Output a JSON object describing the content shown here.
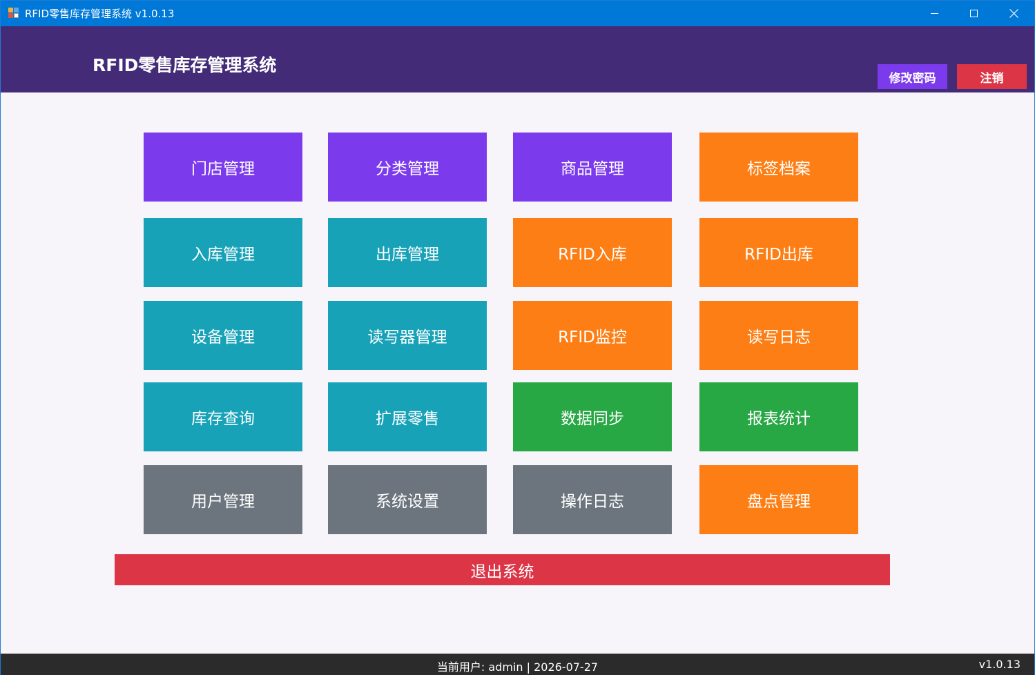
{
  "window": {
    "title": "RFID零售库存管理系统 v1.0.13",
    "icons": {
      "minimize": "minimize-icon",
      "maximize": "maximize-icon",
      "close": "close-icon"
    }
  },
  "header": {
    "title": "RFID零售库存管理系统",
    "change_password": "修改密码",
    "logout": "注销"
  },
  "tiles": [
    {
      "label": "门店管理",
      "color": "#7c3aed"
    },
    {
      "label": "分类管理",
      "color": "#7c3aed"
    },
    {
      "label": "商品管理",
      "color": "#7c3aed"
    },
    {
      "label": "标签档案",
      "color": "#fd7e14"
    },
    {
      "label": "入库管理",
      "color": "#17a2b8"
    },
    {
      "label": "出库管理",
      "color": "#17a2b8"
    },
    {
      "label": "RFID入库",
      "color": "#fd7e14"
    },
    {
      "label": "RFID出库",
      "color": "#fd7e14"
    },
    {
      "label": "设备管理",
      "color": "#17a2b8"
    },
    {
      "label": "读写器管理",
      "color": "#17a2b8"
    },
    {
      "label": "RFID监控",
      "color": "#fd7e14"
    },
    {
      "label": "读写日志",
      "color": "#fd7e14"
    },
    {
      "label": "库存查询",
      "color": "#17a2b8"
    },
    {
      "label": "扩展零售",
      "color": "#17a2b8"
    },
    {
      "label": "数据同步",
      "color": "#28a745"
    },
    {
      "label": "报表统计",
      "color": "#28a745"
    },
    {
      "label": "用户管理",
      "color": "#6c757d"
    },
    {
      "label": "系统设置",
      "color": "#6c757d"
    },
    {
      "label": "操作日志",
      "color": "#6c757d"
    },
    {
      "label": "盘点管理",
      "color": "#fd7e14"
    }
  ],
  "exit_label": "退出系统",
  "status": {
    "text": "当前用户: admin | 2026-07-27",
    "version": "v1.0.13"
  },
  "colors": {
    "header_bg": "#432b78",
    "titlebar_bg": "#0078d7",
    "statusbar_bg": "#2b2b2b",
    "page_bg": "#f8f5fa"
  }
}
